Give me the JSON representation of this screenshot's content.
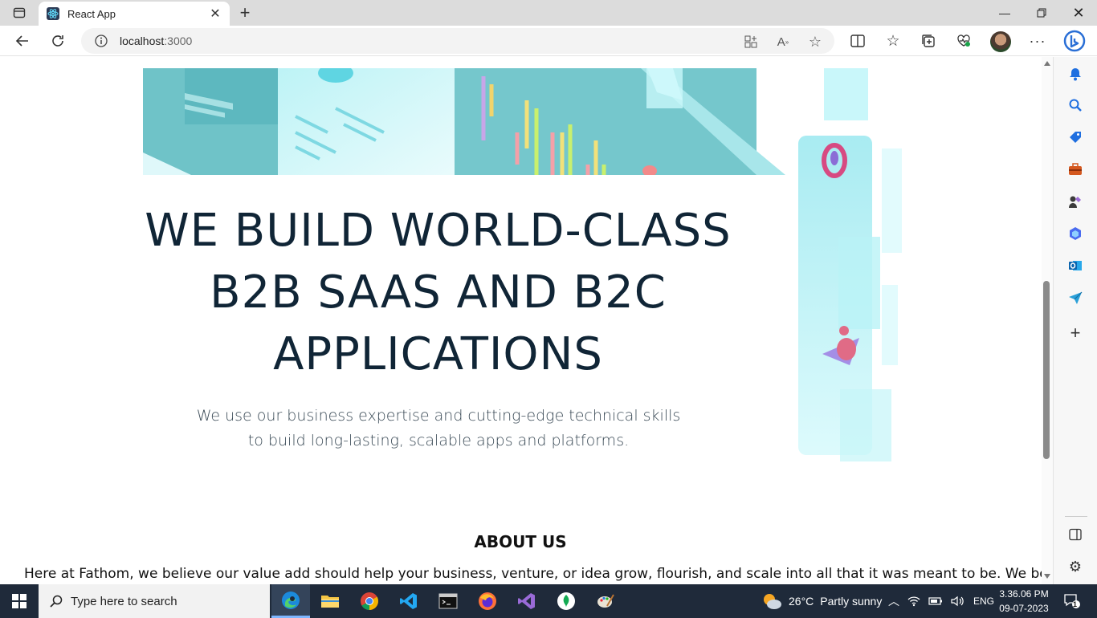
{
  "browser": {
    "tab_title": "React App",
    "url_host": "localhost",
    "url_port": ":3000"
  },
  "page": {
    "headline": [
      "WE BUILD WORLD-CLASS",
      "B2B SAAS AND B2C",
      "APPLICATIONS"
    ],
    "subtext": "We use our business expertise and cutting-edge technical skills to build long-lasting, scalable apps and platforms.",
    "about_title": "ABOUT US",
    "about_text": "Here at Fathom, we believe our value add should help your business, venture, or idea grow, flourish, and scale into all that it was meant to be. We believe the"
  },
  "taskbar": {
    "search_placeholder": "Type here to search",
    "weather_temp": "26°C",
    "weather_desc": "Partly sunny",
    "language": "ENG",
    "time": "3.36.06 PM",
    "date": "09-07-2023",
    "notification_count": "1"
  },
  "colors": {
    "headline": "#102536",
    "accent_teal": "#7fe3ee",
    "taskbar_bg": "#1f2a3a"
  }
}
